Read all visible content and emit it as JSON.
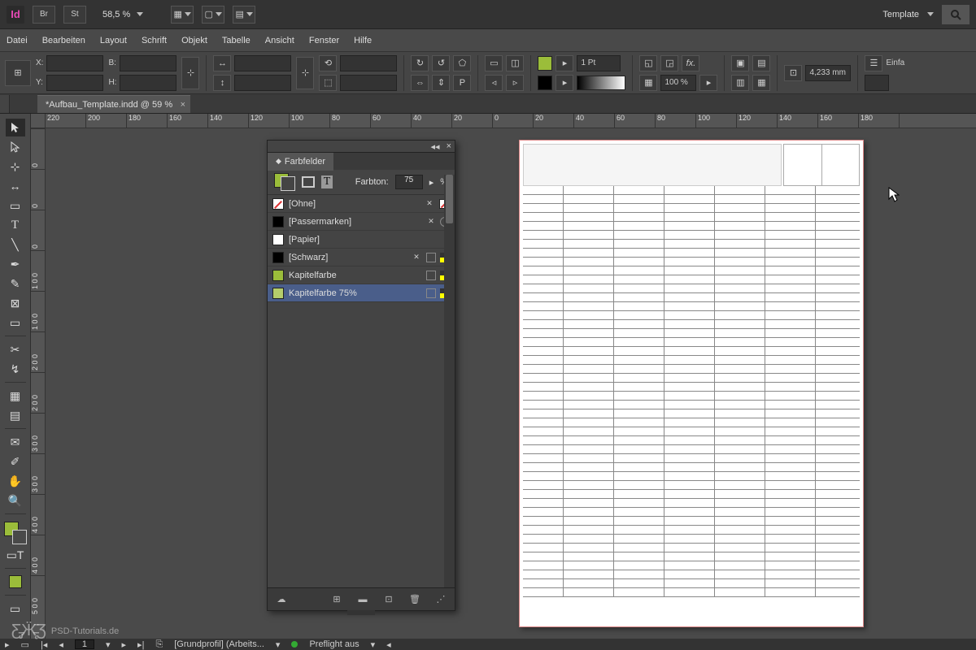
{
  "appbar": {
    "br_label": "Br",
    "st_label": "St",
    "zoom_label": "58,5 %",
    "template_label": "Template"
  },
  "menu": {
    "items": [
      "Datei",
      "Bearbeiten",
      "Layout",
      "Schrift",
      "Objekt",
      "Tabelle",
      "Ansicht",
      "Fenster",
      "Hilfe"
    ]
  },
  "control": {
    "x_label": "X:",
    "y_label": "Y:",
    "b_label": "B:",
    "h_label": "H:",
    "stroke_weight": "1 Pt",
    "opacity": "100 %",
    "width_value": "4,233 mm",
    "right_label": "Einfa"
  },
  "doctab": {
    "title": "*Aufbau_Template.indd @ 59 %"
  },
  "ruler": {
    "h_values": [
      "220",
      "200",
      "180",
      "160",
      "140",
      "120",
      "100",
      "80",
      "60",
      "40",
      "20",
      "0",
      "20",
      "40",
      "60",
      "80",
      "100",
      "120",
      "140",
      "160",
      "180"
    ],
    "v_values": [
      "0",
      "0",
      "0",
      "1 0 0",
      "1 0 0",
      "2 0 0",
      "2 0 0",
      "3 0 0",
      "3 0 0",
      "4 0 0",
      "4 0 0",
      "5 0 0"
    ]
  },
  "panel": {
    "title": "Farbfelder",
    "tint_label": "Farbton:",
    "tint_value": "75",
    "tint_suffix": "%",
    "rows": [
      {
        "name": "[Ohne]",
        "kind": "none",
        "noedit": true,
        "lock_stroke": true
      },
      {
        "name": "[Passermarken]",
        "kind": "reg",
        "noedit": true,
        "reg_icon": true
      },
      {
        "name": "[Papier]",
        "kind": "paper"
      },
      {
        "name": "[Schwarz]",
        "kind": "black",
        "noedit": true,
        "cmyk": true
      },
      {
        "name": "Kapitelfarbe",
        "kind": "lime",
        "cmyk": true
      },
      {
        "name": "Kapitelfarbe 75%",
        "kind": "lime75",
        "cmyk": true,
        "selected": true
      }
    ]
  },
  "status": {
    "page": "1",
    "profile": "[Grundprofil] (Arbeits...",
    "preflight": "Preflight aus"
  },
  "watermark": {
    "text": "PSD-Tutorials.de"
  }
}
